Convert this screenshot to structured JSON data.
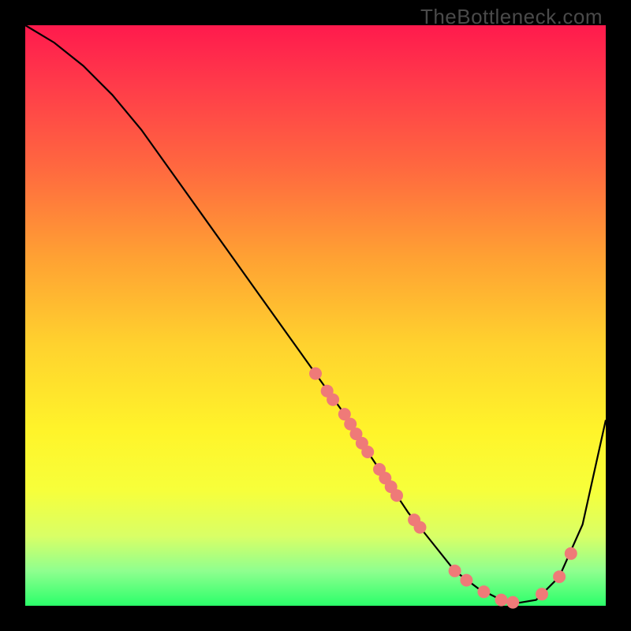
{
  "watermark": "TheBottleneck.com",
  "chart_data": {
    "type": "line",
    "title": "",
    "xlabel": "",
    "ylabel": "",
    "xlim": [
      0,
      100
    ],
    "ylim": [
      0,
      100
    ],
    "grid": false,
    "legend": false,
    "series": [
      {
        "name": "curve",
        "x": [
          0,
          5,
          10,
          15,
          20,
          25,
          30,
          35,
          40,
          45,
          50,
          55,
          58,
          62,
          66,
          70,
          74,
          78,
          82,
          85,
          88,
          92,
          96,
          100
        ],
        "values": [
          100,
          97,
          93,
          88,
          82,
          75,
          68,
          61,
          54,
          47,
          40,
          33,
          28,
          22,
          16,
          11,
          6,
          3,
          1,
          0.5,
          1,
          5,
          14,
          32
        ]
      }
    ],
    "markers": [
      {
        "x": 50,
        "y": 40
      },
      {
        "x": 52,
        "y": 37
      },
      {
        "x": 53,
        "y": 35.5
      },
      {
        "x": 55,
        "y": 33
      },
      {
        "x": 56,
        "y": 31.3
      },
      {
        "x": 57,
        "y": 29.6
      },
      {
        "x": 58,
        "y": 28
      },
      {
        "x": 59,
        "y": 26.5
      },
      {
        "x": 61,
        "y": 23.5
      },
      {
        "x": 62,
        "y": 22
      },
      {
        "x": 63,
        "y": 20.5
      },
      {
        "x": 64,
        "y": 19
      },
      {
        "x": 67,
        "y": 14.8
      },
      {
        "x": 68,
        "y": 13.5
      },
      {
        "x": 74,
        "y": 6
      },
      {
        "x": 76,
        "y": 4.4
      },
      {
        "x": 79,
        "y": 2.4
      },
      {
        "x": 82,
        "y": 1
      },
      {
        "x": 84,
        "y": 0.6
      },
      {
        "x": 89,
        "y": 2
      },
      {
        "x": 92,
        "y": 5
      },
      {
        "x": 94,
        "y": 9
      }
    ],
    "colors": {
      "curve_stroke": "#000000",
      "marker_fill": "#ef7a78",
      "gradient_top": "#ff1a4d",
      "gradient_bottom": "#2bff6a"
    },
    "annotations": []
  }
}
